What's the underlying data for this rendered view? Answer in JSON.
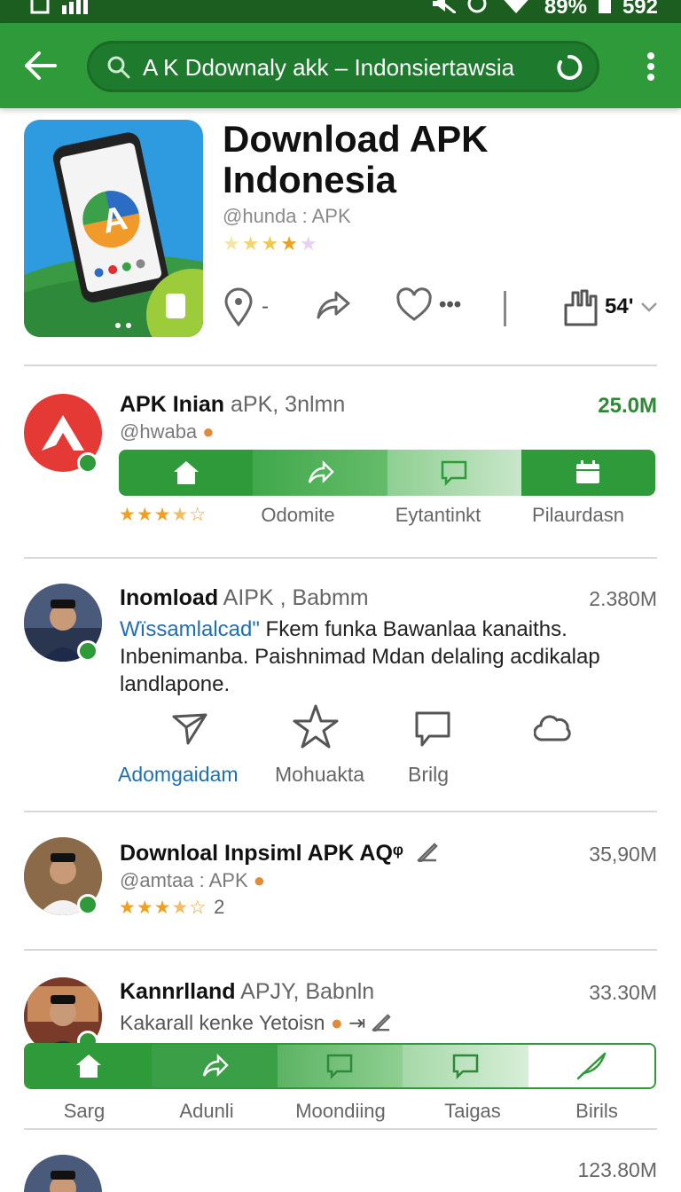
{
  "status_bar": {
    "battery": "89%",
    "time": "592"
  },
  "app_bar": {
    "search_text": "A K Ddownaly akk – Indonsiertawsia"
  },
  "hero": {
    "title_line1": "Download APK",
    "title_line2": "Indonesia",
    "developer": "@hunda : APK",
    "rating_stars": 4,
    "actions": {
      "dash": "-",
      "dots": "•••",
      "count": "54'"
    }
  },
  "items": [
    {
      "title_bold": "APK Inian",
      "title_rest": " aPK, 3nlmn",
      "developer": "@hwaba",
      "size": "25.0M",
      "stars": 3.5,
      "tabs": [
        "Odomite",
        "Eytantinkt",
        "Pilaurdasn"
      ]
    },
    {
      "title_bold": "Inomload",
      "title_rest": " AIPK , Babmm",
      "size": "2.380M",
      "desc_link": "Wïssamlalcad\"",
      "desc_text": " Fkem funka Bawanlaa kanaiths. Inbenimanba. Paishnimad Mdan delaling acdikalap landlapone.",
      "actions": [
        "Adomgaidam",
        "Mohuakta",
        "Brilg"
      ]
    },
    {
      "title_bold": "Downloal Inpsiml APK AQᵠ",
      "title_rest": "",
      "developer": "@amtaa : APK",
      "size": "35,90M",
      "stars": 3.5,
      "rating_count": "2"
    },
    {
      "title_bold": "Kannrlland",
      "title_rest": " APJY, Babnln",
      "developer": "Kakarall kenke  Yetoisn",
      "size": "33.30M",
      "tabs": [
        "Sarg",
        "Adunli",
        "Moondiing",
        "Taigas",
        "Birils"
      ]
    },
    {
      "size": "123.80M"
    }
  ],
  "colors": {
    "primary": "#2e9a3a",
    "primary_dark": "#1b5e20",
    "link": "#1e6fb8",
    "star": "#f0a020"
  }
}
